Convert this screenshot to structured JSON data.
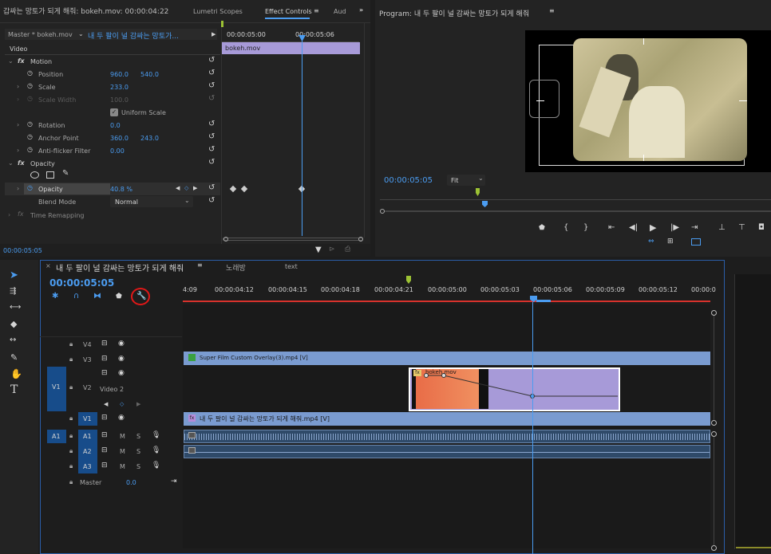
{
  "ec_tabs": {
    "source": "갑싸는 망토가 되게 해줘: bokeh.mov: 00:00:04:22",
    "lumetri": "Lumetri Scopes",
    "effect": "Effect Controls",
    "aud": "Aud"
  },
  "ec": {
    "master": "Master * bokeh.mov",
    "sequence": "내 두 팔이 널 감싸는 망토가...",
    "video": "Video",
    "tc1": "00:00:05:00",
    "tc2": "00:00:05:06",
    "clip": "bokeh.mov",
    "motion": "Motion",
    "position": "Position",
    "pos_x": "960.0",
    "pos_y": "540.0",
    "scale": "Scale",
    "scale_v": "233.0",
    "scale_w": "Scale Width",
    "scale_w_v": "100.0",
    "uniform": "Uniform Scale",
    "rotation": "Rotation",
    "rot_v": "0.0",
    "anchor": "Anchor Point",
    "anc_x": "360.0",
    "anc_y": "243.0",
    "flicker": "Anti-flicker Filter",
    "flicker_v": "0.00",
    "opacity_grp": "Opacity",
    "opacity": "Opacity",
    "opacity_v": "40.8 %",
    "blend": "Blend Mode",
    "blend_v": "Normal",
    "remap": "Time Remapping",
    "footer_tc": "00:00:05:05"
  },
  "pm": {
    "title": "Program: 내 두 팔이 널 감싸는 망토가 되게 해줘",
    "tc": "00:00:05:05",
    "fit": "Fit"
  },
  "tl": {
    "tab1": "내 두 팔이 널 감싸는 망토가 되게 해줘",
    "tab2": "노래방",
    "tab3": "text",
    "tc": "00:00:05:05",
    "ruler": [
      "4:09",
      "00:00:04:12",
      "00:00:04:15",
      "00:00:04:18",
      "00:00:04:21",
      "00:00:05:00",
      "00:00:05:03",
      "00:00:05:06",
      "00:00:05:09",
      "00:00:05:12",
      "00:00:0"
    ],
    "tracks": {
      "v4": "V4",
      "v3": "V3",
      "v2": "V2",
      "v2name": "Video 2",
      "v1": "V1",
      "v1b": "V1",
      "a1": "A1",
      "a1b": "A1",
      "a2": "A2",
      "a3": "A3",
      "master": "Master",
      "master_v": "0.0",
      "m": "M",
      "s": "S"
    },
    "clips": {
      "overlay": "Super Film Custom Overlay(3).mp4 [V]",
      "bokeh": "bokeh.mov",
      "main": "내 두 팔이 널 감싸는 망토가 되게 해줘.mp4 [V]"
    }
  },
  "colors": {
    "accent": "#4b9cf0",
    "clip_purple": "#a79ad8",
    "clip_blue": "#7a9bd0",
    "playhead": "#6fa8f5"
  }
}
